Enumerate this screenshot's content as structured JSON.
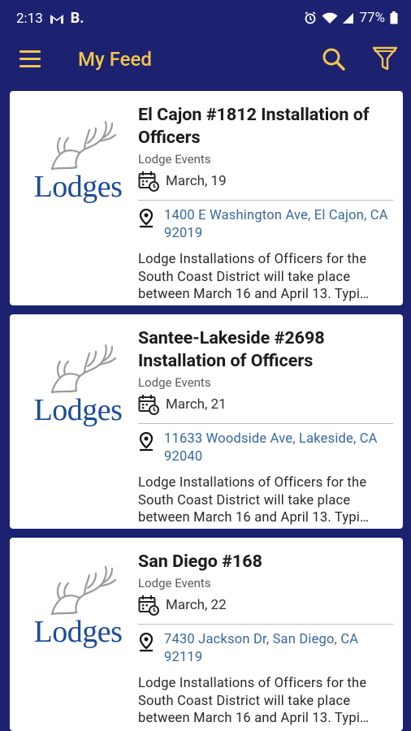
{
  "status_bar": {
    "time": "2:13",
    "carrier_icons": [
      "gmail-icon"
    ],
    "carrier_letter": "B.",
    "battery": "77%"
  },
  "app_bar": {
    "title": "My Feed",
    "accent_color": "#f3c64b",
    "background_color": "#1c2170"
  },
  "cards": [
    {
      "logo_text": "Lodges",
      "title": "El Cajon #1812 Installation of Officers",
      "category": "Lodge Events",
      "date": "March, 19",
      "address": "1400 E Washington Ave, El Cajon, CA 92019",
      "description": "Lodge Installations of Officers for the South Coast District will take place between March 16 and April 13.  Typi…"
    },
    {
      "logo_text": "Lodges",
      "title": "Santee-Lakeside #2698 Installation of Officers",
      "category": "Lodge Events",
      "date": "March, 21",
      "address": "11633 Woodside Ave, Lakeside, CA 92040",
      "description": "Lodge Installations of Officers for the South Coast District will take place between March 16 and April 13.  Typi…"
    },
    {
      "logo_text": "Lodges",
      "title": "San Diego #168",
      "category": "Lodge Events",
      "date": "March, 22",
      "address": "7430 Jackson Dr, San Diego, CA 92119",
      "description": "Lodge Installations of Officers for the South Coast District will take place between March 16 and April 13.  Typi…"
    }
  ]
}
